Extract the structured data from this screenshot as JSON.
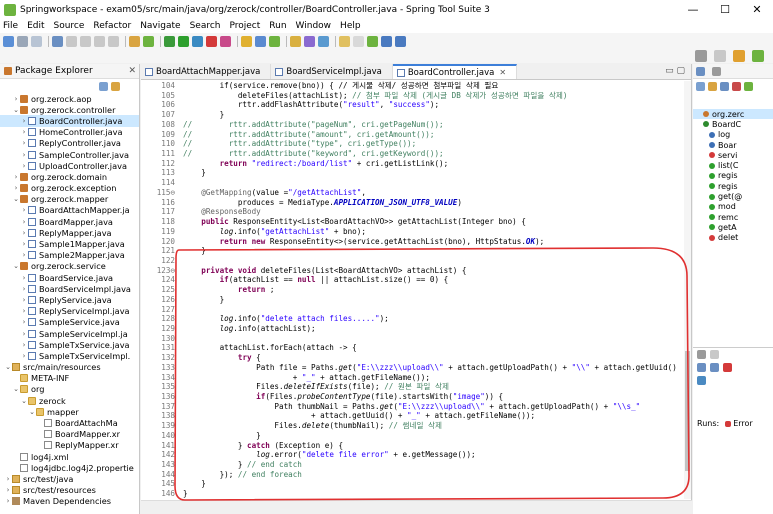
{
  "window": {
    "title": "Springworkspace - exam05/src/main/java/org/zerock/controller/BoardController.java - Spring Tool Suite 3",
    "min": "—",
    "max": "☐",
    "close": "✕"
  },
  "menu": [
    "File",
    "Edit",
    "Source",
    "Refactor",
    "Navigate",
    "Search",
    "Project",
    "Run",
    "Window",
    "Help"
  ],
  "package_explorer": {
    "title": "Package Explorer",
    "close": "✕",
    "tree": [
      {
        "indent": 1,
        "tw": "›",
        "icon": "pkgic",
        "label": "org.zerock.aop"
      },
      {
        "indent": 1,
        "tw": "⌄",
        "icon": "pkgic",
        "label": "org.zerock.controller"
      },
      {
        "indent": 2,
        "tw": "›",
        "icon": "java",
        "label": "BoardController.java",
        "selected": true
      },
      {
        "indent": 2,
        "tw": "›",
        "icon": "java",
        "label": "HomeController.java"
      },
      {
        "indent": 2,
        "tw": "›",
        "icon": "java",
        "label": "ReplyController.java"
      },
      {
        "indent": 2,
        "tw": "›",
        "icon": "java",
        "label": "SampleController.java"
      },
      {
        "indent": 2,
        "tw": "›",
        "icon": "java",
        "label": "UploadController.java"
      },
      {
        "indent": 1,
        "tw": "›",
        "icon": "pkgic",
        "label": "org.zerock.domain"
      },
      {
        "indent": 1,
        "tw": "›",
        "icon": "pkgic",
        "label": "org.zerock.exception"
      },
      {
        "indent": 1,
        "tw": "⌄",
        "icon": "pkgic",
        "label": "org.zerock.mapper"
      },
      {
        "indent": 2,
        "tw": "›",
        "icon": "java",
        "label": "BoardAttachMapper.ja"
      },
      {
        "indent": 2,
        "tw": "›",
        "icon": "java",
        "label": "BoardMapper.java"
      },
      {
        "indent": 2,
        "tw": "›",
        "icon": "java",
        "label": "ReplyMapper.java"
      },
      {
        "indent": 2,
        "tw": "›",
        "icon": "java",
        "label": "Sample1Mapper.java"
      },
      {
        "indent": 2,
        "tw": "›",
        "icon": "java",
        "label": "Sample2Mapper.java"
      },
      {
        "indent": 1,
        "tw": "⌄",
        "icon": "pkgic",
        "label": "org.zerock.service"
      },
      {
        "indent": 2,
        "tw": "›",
        "icon": "java",
        "label": "BoardService.java"
      },
      {
        "indent": 2,
        "tw": "›",
        "icon": "java",
        "label": "BoardServiceImpl.java"
      },
      {
        "indent": 2,
        "tw": "›",
        "icon": "java",
        "label": "ReplyService.java"
      },
      {
        "indent": 2,
        "tw": "›",
        "icon": "java",
        "label": "ReplyServiceImpl.java"
      },
      {
        "indent": 2,
        "tw": "›",
        "icon": "java",
        "label": "SampleService.java"
      },
      {
        "indent": 2,
        "tw": "›",
        "icon": "java",
        "label": "SampleServiceImpl.ja"
      },
      {
        "indent": 2,
        "tw": "›",
        "icon": "java",
        "label": "SampleTxService.java"
      },
      {
        "indent": 2,
        "tw": "›",
        "icon": "java",
        "label": "SampleTxServiceImpl."
      },
      {
        "indent": 0,
        "tw": "⌄",
        "icon": "srcf",
        "label": "src/main/resources"
      },
      {
        "indent": 1,
        "tw": "",
        "icon": "folder",
        "label": "META-INF"
      },
      {
        "indent": 1,
        "tw": "⌄",
        "icon": "folder",
        "label": "org"
      },
      {
        "indent": 2,
        "tw": "⌄",
        "icon": "folder",
        "label": "zerock"
      },
      {
        "indent": 3,
        "tw": "⌄",
        "icon": "folder",
        "label": "mapper"
      },
      {
        "indent": 4,
        "tw": "",
        "icon": "xml",
        "label": "BoardAttachMa"
      },
      {
        "indent": 4,
        "tw": "",
        "icon": "xml",
        "label": "BoardMapper.xr"
      },
      {
        "indent": 4,
        "tw": "",
        "icon": "xml",
        "label": "ReplyMapper.xr"
      },
      {
        "indent": 1,
        "tw": "",
        "icon": "xml",
        "label": "log4j.xml"
      },
      {
        "indent": 1,
        "tw": "",
        "icon": "xml",
        "label": "log4jdbc.log4j2.propertie"
      },
      {
        "indent": 0,
        "tw": "›",
        "icon": "srcf",
        "label": "src/test/java"
      },
      {
        "indent": 0,
        "tw": "›",
        "icon": "srcf",
        "label": "src/test/resources"
      },
      {
        "indent": 0,
        "tw": "›",
        "icon": "lib",
        "label": "Maven Dependencies"
      }
    ]
  },
  "editor": {
    "tabs": [
      {
        "label": "BoardAttachMapper.java",
        "active": false
      },
      {
        "label": "BoardServiceImpl.java",
        "active": false
      },
      {
        "label": "BoardController.java",
        "active": true
      }
    ],
    "tab_close": "✕",
    "lines": [
      {
        "n": "104",
        "spans": [
          {
            "c": "",
            "t": "        if(service.remove(bno)) { // 게시물 삭제/ 성공하면 첨부파일 삭제 필요"
          }
        ]
      },
      {
        "n": "105",
        "spans": [
          {
            "c": "",
            "t": "            deleteFiles(attachList); "
          },
          {
            "c": "cm",
            "t": "// 첨부 파일 삭제 (게시글 DB 삭제가 성공하면 파일을 삭제)"
          }
        ]
      },
      {
        "n": "106",
        "spans": [
          {
            "c": "",
            "t": "            rttr.addFlashAttribute("
          },
          {
            "c": "str",
            "t": "\"result\""
          },
          {
            "c": "",
            "t": ", "
          },
          {
            "c": "str",
            "t": "\"success\""
          },
          {
            "c": "",
            "t": ");"
          }
        ]
      },
      {
        "n": "107",
        "spans": [
          {
            "c": "",
            "t": "        }"
          }
        ]
      },
      {
        "n": "108",
        "spans": [
          {
            "c": "cm",
            "t": "//        rttr.addAttribute(\"pageNum\", cri.getPageNum());"
          }
        ]
      },
      {
        "n": "109",
        "spans": [
          {
            "c": "cm",
            "t": "//        rttr.addAttribute(\"amount\", cri.getAmount());"
          }
        ]
      },
      {
        "n": "110",
        "spans": [
          {
            "c": "cm",
            "t": "//        rttr.addAttribute(\"type\", cri.getType());"
          }
        ]
      },
      {
        "n": "111",
        "spans": [
          {
            "c": "cm",
            "t": "//        rttr.addAttribute(\"keyword\", cri.getKeyword());"
          }
        ]
      },
      {
        "n": "112",
        "spans": [
          {
            "c": "",
            "t": "        "
          },
          {
            "c": "kw",
            "t": "return"
          },
          {
            "c": "",
            "t": " "
          },
          {
            "c": "str",
            "t": "\"redirect:/board/list\""
          },
          {
            "c": "",
            "t": " + cri.getListLink();"
          }
        ]
      },
      {
        "n": "113",
        "spans": [
          {
            "c": "",
            "t": "    }"
          }
        ]
      },
      {
        "n": "114",
        "spans": [
          {
            "c": "",
            "t": ""
          }
        ]
      },
      {
        "n": "115⊖",
        "spans": [
          {
            "c": "an",
            "t": "    @GetMapping"
          },
          {
            "c": "",
            "t": "(value ="
          },
          {
            "c": "str",
            "t": "\"/getAttachList\""
          },
          {
            "c": "",
            "t": ","
          }
        ]
      },
      {
        "n": "116",
        "spans": [
          {
            "c": "",
            "t": "            produces = MediaType."
          },
          {
            "c": "cst",
            "t": "APPLICATION_JSON_UTF8_VALUE"
          },
          {
            "c": "",
            "t": ")"
          }
        ]
      },
      {
        "n": "117",
        "spans": [
          {
            "c": "an",
            "t": "    @ResponseBody"
          }
        ]
      },
      {
        "n": "118",
        "spans": [
          {
            "c": "kw",
            "t": "    public"
          },
          {
            "c": "",
            "t": " ResponseEntity<List<BoardAttachVO>> getAttachList(Integer bno) {"
          }
        ]
      },
      {
        "n": "119",
        "spans": [
          {
            "c": "",
            "t": "        "
          },
          {
            "c": "it",
            "t": "log"
          },
          {
            "c": "",
            "t": ".info("
          },
          {
            "c": "str",
            "t": "\"getAttachList\""
          },
          {
            "c": "",
            "t": " + bno);"
          }
        ]
      },
      {
        "n": "120",
        "spans": [
          {
            "c": "",
            "t": "        "
          },
          {
            "c": "kw",
            "t": "return new"
          },
          {
            "c": "",
            "t": " ResponseEntity<>(service.getAttachList(bno), HttpStatus."
          },
          {
            "c": "cst",
            "t": "OK"
          },
          {
            "c": "",
            "t": ");"
          }
        ]
      },
      {
        "n": "121",
        "spans": [
          {
            "c": "",
            "t": "    }"
          }
        ]
      },
      {
        "n": "122",
        "spans": [
          {
            "c": "",
            "t": ""
          }
        ]
      },
      {
        "n": "123⊖",
        "spans": [
          {
            "c": "kw",
            "t": "    private void"
          },
          {
            "c": "",
            "t": " deleteFiles(List<BoardAttachVO> attachList) {"
          }
        ]
      },
      {
        "n": "124",
        "spans": [
          {
            "c": "",
            "t": "        "
          },
          {
            "c": "kw",
            "t": "if"
          },
          {
            "c": "",
            "t": "(attachList == "
          },
          {
            "c": "kw",
            "t": "null"
          },
          {
            "c": "",
            "t": " || attachList.size() == 0) {"
          }
        ]
      },
      {
        "n": "125",
        "spans": [
          {
            "c": "",
            "t": "            "
          },
          {
            "c": "kw",
            "t": "return"
          },
          {
            "c": "",
            "t": " ;"
          }
        ]
      },
      {
        "n": "126",
        "spans": [
          {
            "c": "",
            "t": "        }"
          }
        ]
      },
      {
        "n": "127",
        "spans": [
          {
            "c": "",
            "t": ""
          }
        ]
      },
      {
        "n": "128",
        "spans": [
          {
            "c": "",
            "t": "        "
          },
          {
            "c": "it",
            "t": "log"
          },
          {
            "c": "",
            "t": ".info("
          },
          {
            "c": "str",
            "t": "\"delete attach files.....\""
          },
          {
            "c": "",
            "t": ");"
          }
        ]
      },
      {
        "n": "129",
        "spans": [
          {
            "c": "",
            "t": "        "
          },
          {
            "c": "it",
            "t": "log"
          },
          {
            "c": "",
            "t": ".info(attachList);"
          }
        ]
      },
      {
        "n": "130",
        "spans": [
          {
            "c": "",
            "t": ""
          }
        ]
      },
      {
        "n": "131",
        "spans": [
          {
            "c": "",
            "t": "        attachList.forEach(attach -> {"
          }
        ]
      },
      {
        "n": "132",
        "spans": [
          {
            "c": "",
            "t": "            "
          },
          {
            "c": "kw",
            "t": "try"
          },
          {
            "c": "",
            "t": " {"
          }
        ]
      },
      {
        "n": "133",
        "spans": [
          {
            "c": "",
            "t": "                Path file = Paths."
          },
          {
            "c": "it",
            "t": "get"
          },
          {
            "c": "",
            "t": "("
          },
          {
            "c": "str",
            "t": "\"E:\\\\zzz\\\\upload\\\\\""
          },
          {
            "c": "",
            "t": " + attach.getUploadPath() + "
          },
          {
            "c": "str",
            "t": "\"\\\\\""
          },
          {
            "c": "",
            "t": " + attach.getUuid()"
          }
        ]
      },
      {
        "n": "134",
        "spans": [
          {
            "c": "",
            "t": "                        + "
          },
          {
            "c": "str",
            "t": "\"_\""
          },
          {
            "c": "",
            "t": " + attach.getFileName());"
          }
        ]
      },
      {
        "n": "135",
        "spans": [
          {
            "c": "",
            "t": "                Files."
          },
          {
            "c": "it",
            "t": "deleteIfExists"
          },
          {
            "c": "",
            "t": "(file); "
          },
          {
            "c": "cm",
            "t": "// 원본 파일 삭제"
          }
        ]
      },
      {
        "n": "136",
        "spans": [
          {
            "c": "",
            "t": "                "
          },
          {
            "c": "kw",
            "t": "if"
          },
          {
            "c": "",
            "t": "(Files."
          },
          {
            "c": "it",
            "t": "probeContentType"
          },
          {
            "c": "",
            "t": "(file).startsWith("
          },
          {
            "c": "str",
            "t": "\"image\""
          },
          {
            "c": "",
            "t": ")) {"
          }
        ]
      },
      {
        "n": "137",
        "spans": [
          {
            "c": "",
            "t": "                    Path thumbNail = Paths."
          },
          {
            "c": "it",
            "t": "get"
          },
          {
            "c": "",
            "t": "("
          },
          {
            "c": "str",
            "t": "\"E:\\\\zzz\\\\upload\\\\\""
          },
          {
            "c": "",
            "t": " + attach.getUploadPath() + "
          },
          {
            "c": "str",
            "t": "\"\\\\s_\""
          }
        ]
      },
      {
        "n": "138",
        "spans": [
          {
            "c": "",
            "t": "                            + attach.getUuid() + "
          },
          {
            "c": "str",
            "t": "\"_\""
          },
          {
            "c": "",
            "t": " + attach.getFileName());"
          }
        ]
      },
      {
        "n": "139",
        "spans": [
          {
            "c": "",
            "t": "                    Files."
          },
          {
            "c": "it",
            "t": "delete"
          },
          {
            "c": "",
            "t": "(thumbNail); "
          },
          {
            "c": "cm",
            "t": "// 썸네일 삭제"
          }
        ]
      },
      {
        "n": "140",
        "spans": [
          {
            "c": "",
            "t": "                }"
          }
        ]
      },
      {
        "n": "141",
        "spans": [
          {
            "c": "",
            "t": "            } "
          },
          {
            "c": "kw",
            "t": "catch"
          },
          {
            "c": "",
            "t": " (Exception e) {"
          }
        ]
      },
      {
        "n": "142",
        "spans": [
          {
            "c": "",
            "t": "                "
          },
          {
            "c": "it",
            "t": "log"
          },
          {
            "c": "",
            "t": ".error("
          },
          {
            "c": "str",
            "t": "\"delete file error\""
          },
          {
            "c": "",
            "t": " + e.getMessage());"
          }
        ]
      },
      {
        "n": "143",
        "spans": [
          {
            "c": "",
            "t": "            } "
          },
          {
            "c": "cm",
            "t": "// end catch"
          }
        ]
      },
      {
        "n": "144",
        "spans": [
          {
            "c": "",
            "t": "        }); "
          },
          {
            "c": "cm",
            "t": "// end foreach"
          }
        ]
      },
      {
        "n": "145",
        "spans": [
          {
            "c": "",
            "t": "    }"
          }
        ]
      },
      {
        "n": "146",
        "spans": [
          {
            "c": "",
            "t": "}"
          }
        ]
      },
      {
        "n": "147",
        "spans": [
          {
            "c": "",
            "t": ""
          }
        ]
      }
    ]
  },
  "outline": {
    "items": [
      {
        "label": "org.zerc",
        "color": "#c9772e",
        "indent": 1,
        "selected": true
      },
      {
        "label": "BoardC",
        "color": "#2e8b2e",
        "indent": 1
      },
      {
        "label": "log",
        "color": "#3d6fb5",
        "indent": 2
      },
      {
        "label": "Boar",
        "color": "#3d6fb5",
        "indent": 2
      },
      {
        "label": "servi",
        "color": "#d43a3a",
        "indent": 2
      },
      {
        "label": "list(C",
        "color": "#2ea02e",
        "indent": 2
      },
      {
        "label": "regis",
        "color": "#2ea02e",
        "indent": 2
      },
      {
        "label": "regis",
        "color": "#2ea02e",
        "indent": 2
      },
      {
        "label": "get(@",
        "color": "#2ea02e",
        "indent": 2
      },
      {
        "label": "mod",
        "color": "#2ea02e",
        "indent": 2
      },
      {
        "label": "remc",
        "color": "#2ea02e",
        "indent": 2
      },
      {
        "label": "getA",
        "color": "#2ea02e",
        "indent": 2
      },
      {
        "label": "delet",
        "color": "#d43a3a",
        "indent": 2
      }
    ],
    "runs_label": "Runs:",
    "errors_label": "Error"
  },
  "colors": {
    "annotation_stroke": "#e03030",
    "selection": "#cce8ff",
    "tab_accent": "#3d7fd9"
  }
}
